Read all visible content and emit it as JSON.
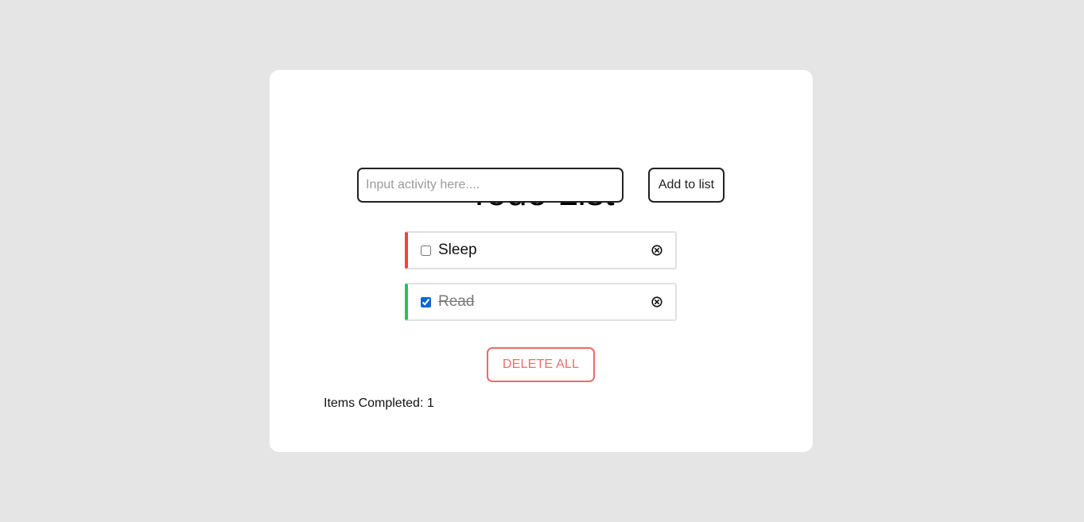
{
  "app": {
    "title": "Todo List"
  },
  "form": {
    "input_value": "",
    "input_placeholder": "Input activity here....",
    "add_label": "Add to list"
  },
  "todos": [
    {
      "label": "Sleep",
      "completed": false,
      "accent_color": "#ef4444",
      "remove_icon": "circle-x-icon"
    },
    {
      "label": "Read",
      "completed": true,
      "accent_color": "#22c55e",
      "remove_icon": "circle-x-icon"
    }
  ],
  "actions": {
    "delete_all_label": "DELETE ALL"
  },
  "summary": {
    "label": "Items Completed:",
    "count": "1"
  },
  "colors": {
    "background": "#e5e5e5",
    "card": "#ffffff",
    "danger": "#ef6b6b",
    "pending_accent": "#ef4444",
    "done_accent": "#22c55e"
  }
}
